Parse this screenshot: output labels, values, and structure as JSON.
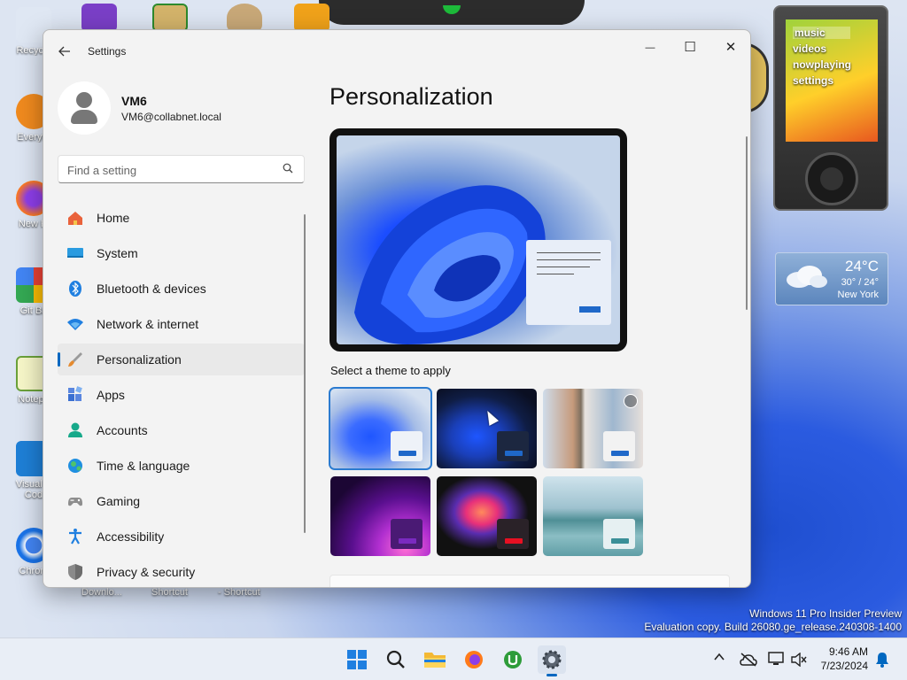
{
  "desktop": {
    "icons": [
      {
        "label": "Recycle"
      },
      {
        "label": "Everyth"
      },
      {
        "label": "New Fi"
      },
      {
        "label": "Git Ba"
      },
      {
        "label": "Notepa"
      },
      {
        "label": "Visual S"
      },
      {
        "label": "Cod"
      },
      {
        "label": "Chrom"
      }
    ],
    "below_labels": [
      "Downlo...",
      "Shortcut",
      "- Shortcut"
    ],
    "watermark_line1": "Windows 11 Pro Insider Preview",
    "watermark_line2": "Evaluation copy. Build 26080.ge_release.240308-1400"
  },
  "zune": {
    "menu": [
      "music",
      "videos",
      "nowplaying",
      "settings"
    ]
  },
  "weather": {
    "temperature": "24°C",
    "range": "30° / 24°",
    "city": "New York"
  },
  "window": {
    "title": "Settings",
    "controls": {
      "minimize": "—",
      "maximize": "☐",
      "close": "✕"
    }
  },
  "profile": {
    "name": "VM6",
    "email": "VM6@collabnet.local"
  },
  "search": {
    "placeholder": "Find a setting"
  },
  "nav": {
    "items": [
      {
        "label": "Home",
        "icon": "home-icon"
      },
      {
        "label": "System",
        "icon": "system-icon"
      },
      {
        "label": "Bluetooth & devices",
        "icon": "bluetooth-icon"
      },
      {
        "label": "Network & internet",
        "icon": "wifi-icon"
      },
      {
        "label": "Personalization",
        "icon": "paintbrush-icon",
        "selected": true
      },
      {
        "label": "Apps",
        "icon": "apps-icon"
      },
      {
        "label": "Accounts",
        "icon": "account-icon"
      },
      {
        "label": "Time & language",
        "icon": "globe-clock-icon"
      },
      {
        "label": "Gaming",
        "icon": "gamepad-icon"
      },
      {
        "label": "Accessibility",
        "icon": "accessibility-icon"
      },
      {
        "label": "Privacy & security",
        "icon": "shield-icon"
      }
    ]
  },
  "main": {
    "page_title": "Personalization",
    "theme_section_label": "Select a theme to apply",
    "themes": [
      {
        "name": "windows-light",
        "selected": true
      },
      {
        "name": "windows-dark"
      },
      {
        "name": "spotlight"
      },
      {
        "name": "glow"
      },
      {
        "name": "captured-motion"
      },
      {
        "name": "flow"
      }
    ]
  },
  "taskbar": {
    "time": "9:46 AM",
    "date": "7/23/2024",
    "apps": [
      "start-icon",
      "search-icon",
      "file-explorer-icon",
      "firefox-icon",
      "utorrent-icon",
      "settings-icon"
    ]
  },
  "colors": {
    "accent": "#0067c0",
    "window_bg": "#f3f3f3"
  }
}
